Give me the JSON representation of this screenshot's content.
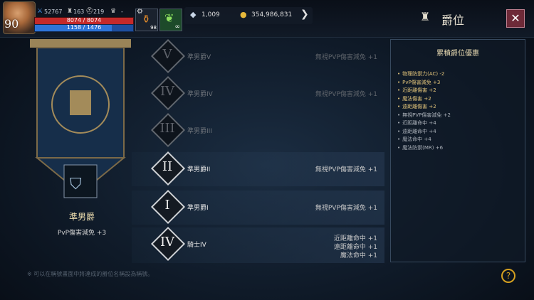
{
  "player": {
    "level": "90",
    "combat": "52767",
    "stat2": "163",
    "stat3": "219",
    "stat4": "-",
    "hp_text": "8074 / 8074",
    "mp_text": "1158 / 1476",
    "hp_fraction": 1.0,
    "mp_fraction": 0.7846
  },
  "slots": {
    "potion_count": "98",
    "buff_count": "∞"
  },
  "currency": {
    "diamonds": "1,009",
    "gold": "354,986,831"
  },
  "header": {
    "title": "爵位",
    "close_label": "✕"
  },
  "rank": {
    "current_name": "準男爵",
    "current_bonus": "PvP傷害減免 +3"
  },
  "ranks": [
    {
      "numeral": "V",
      "name": "準男爵V",
      "bonuses": [
        "無視PVP傷害減免 +1"
      ],
      "active": false
    },
    {
      "numeral": "IV",
      "name": "準男爵IV",
      "bonuses": [
        "無視PVP傷害減免 +1"
      ],
      "active": false
    },
    {
      "numeral": "III",
      "name": "準男爵III",
      "bonuses": [
        ""
      ],
      "active": false
    },
    {
      "numeral": "II",
      "name": "準男爵II",
      "bonuses": [
        "無視PVP傷害減免 +1"
      ],
      "active": true
    },
    {
      "numeral": "I",
      "name": "準男爵I",
      "bonuses": [
        "無視PVP傷害減免 +1"
      ],
      "active": true
    },
    {
      "numeral": "IV",
      "name": "騎士IV",
      "bonuses": [
        "近距離命中 +1",
        "遠距離命中 +1",
        "魔法命中 +1"
      ],
      "active": true
    }
  ],
  "reward_box": {
    "title": "累積爵位優惠",
    "items": [
      {
        "text": "物理防禦力(AC) -2",
        "color": "#e2c47a"
      },
      {
        "text": "PvP傷害減免 +3",
        "color": "#e2c47a"
      },
      {
        "text": "近距離傷害 +2",
        "color": "#e2c47a"
      },
      {
        "text": "魔法傷害 +2",
        "color": "#e2c47a"
      },
      {
        "text": "遠距離傷害 +2",
        "color": "#e2c47a"
      },
      {
        "text": "無視PVP傷害減免 +2",
        "color": "#aab0b8"
      },
      {
        "text": "近距離命中 +4",
        "color": "#aab0b8"
      },
      {
        "text": "遠距離命中 +4",
        "color": "#aab0b8"
      },
      {
        "text": "魔法命中 +4",
        "color": "#aab0b8"
      },
      {
        "text": "魔法防禦(MR) +6",
        "color": "#aab0b8"
      }
    ]
  },
  "footer": {
    "note": "※ 可以在稱號畫面中將達成的爵位名稱設為稱號。",
    "help_label": "?"
  }
}
